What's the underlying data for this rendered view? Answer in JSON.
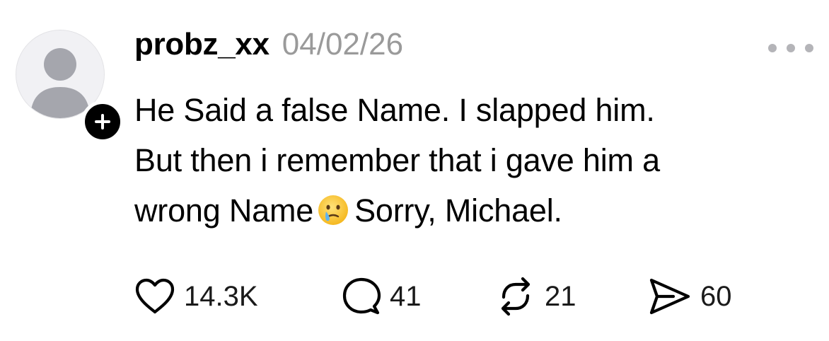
{
  "post": {
    "username": "probz_xx",
    "date": "04/02/26",
    "more_icon": "ellipsis-icon",
    "avatar_icon": "default-avatar-icon",
    "follow_icon": "plus-icon",
    "text_lines": [
      "He Said a false Name. I slapped him.",
      "But then i remember that i gave him a",
      "wrong Name",
      "Sorry, Michael."
    ],
    "emoji": "face-holding-back-tears-icon"
  },
  "actions": {
    "like": {
      "icon": "heart-icon",
      "count": "14.3K"
    },
    "reply": {
      "icon": "comment-bubble-icon",
      "count": "41"
    },
    "repost": {
      "icon": "repost-icon",
      "count": "21"
    },
    "share": {
      "icon": "send-icon",
      "count": "60"
    }
  },
  "colors": {
    "text": "#000000",
    "muted": "#9a9a9a",
    "more_dots": "#b4b4b8",
    "avatar_bg": "#f1f1f4",
    "avatar_figure": "#a5a6ad",
    "badge": "#000000"
  }
}
